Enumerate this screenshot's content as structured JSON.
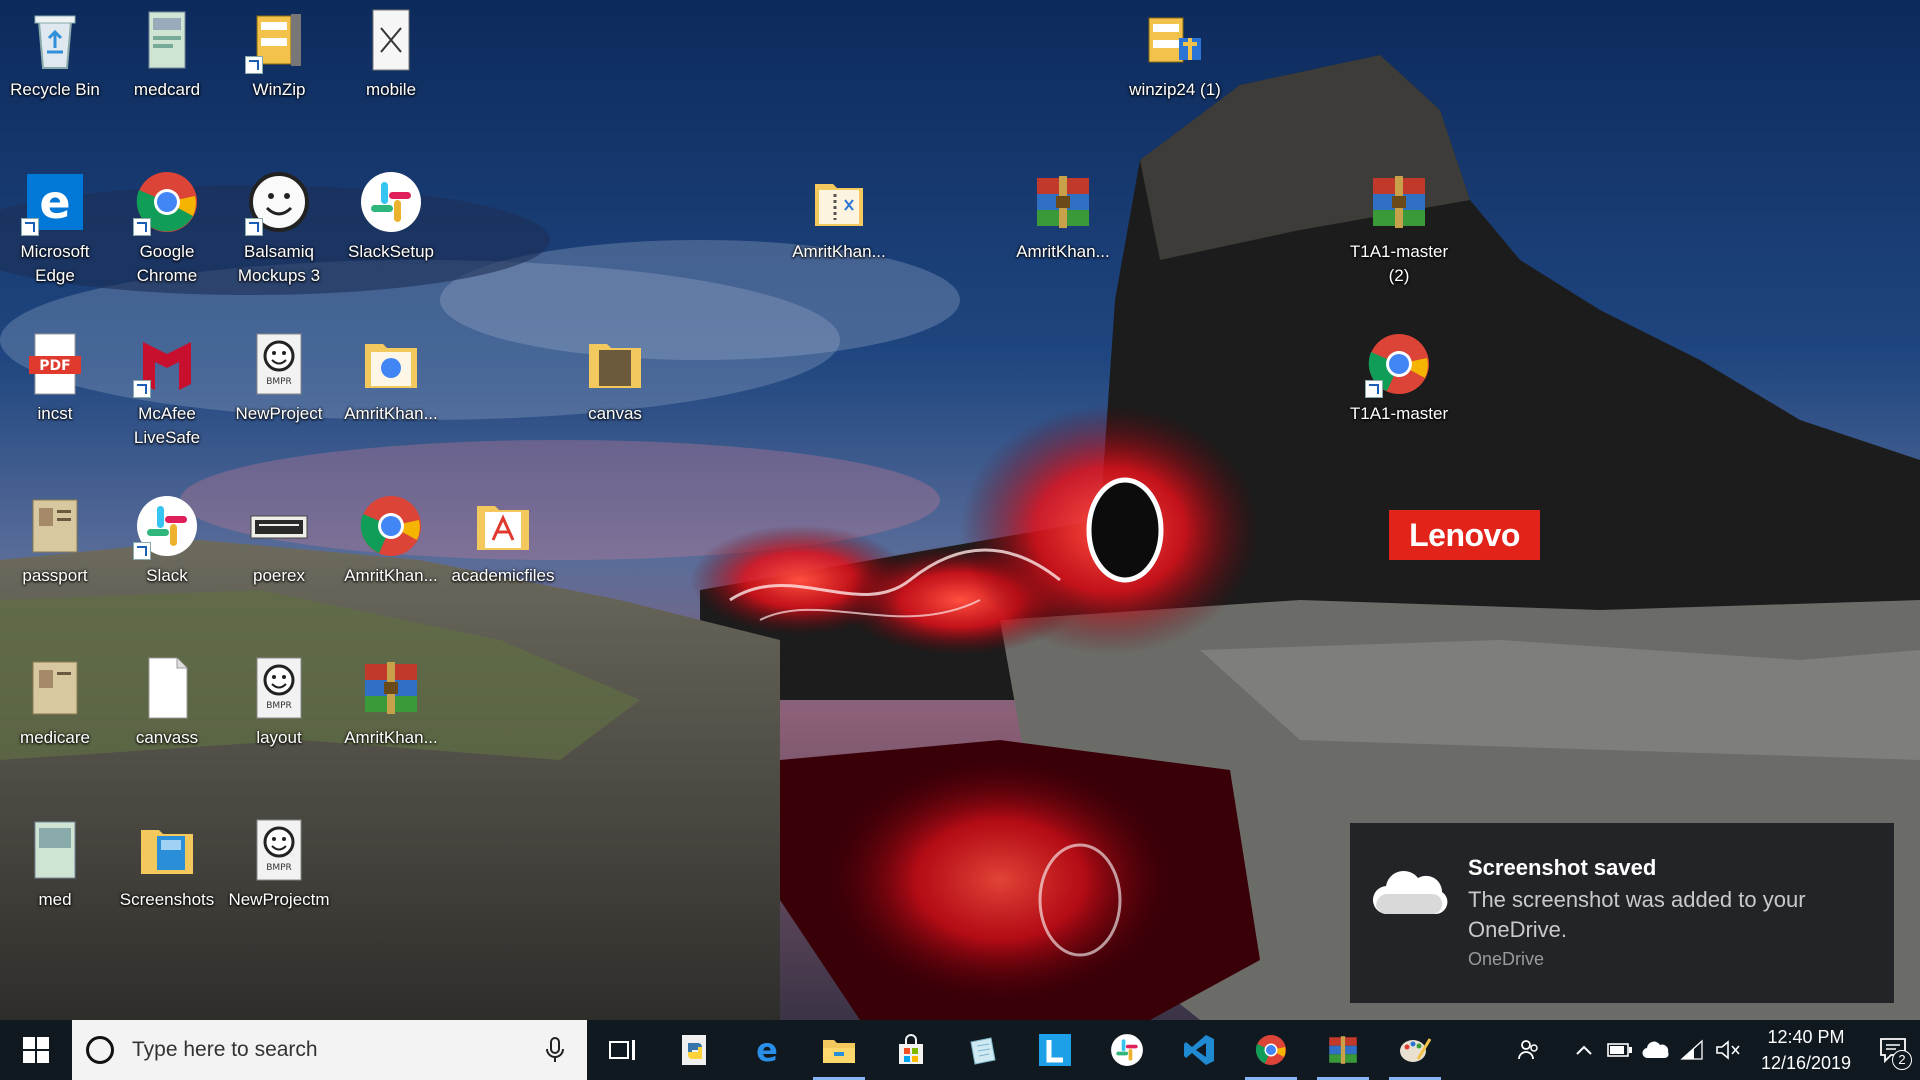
{
  "desktop": {
    "icons": [
      {
        "label": "Recycle Bin",
        "icon": "recycle-bin-icon"
      },
      {
        "label": "medcard",
        "icon": "image-file-icon"
      },
      {
        "label": "WinZip",
        "icon": "winzip-icon"
      },
      {
        "label": "mobile",
        "icon": "document-file-icon"
      },
      {
        "label": "winzip24 (1)",
        "icon": "installer-icon"
      },
      {
        "label": "Microsoft Edge",
        "icon": "edge-icon"
      },
      {
        "label": "Google Chrome",
        "icon": "chrome-icon"
      },
      {
        "label": "Balsamiq Mockups 3",
        "icon": "balsamiq-icon"
      },
      {
        "label": "SlackSetup",
        "icon": "slack-icon"
      },
      {
        "label": "AmritKhan...",
        "icon": "zip-folder-icon"
      },
      {
        "label": "AmritKhan...",
        "icon": "winrar-archive-icon"
      },
      {
        "label": "T1A1-master (2)",
        "icon": "winrar-archive-icon"
      },
      {
        "label": "incst",
        "icon": "pdf-file-icon"
      },
      {
        "label": "McAfee LiveSafe",
        "icon": "mcafee-icon"
      },
      {
        "label": "NewProject",
        "icon": "bmpr-file-icon"
      },
      {
        "label": "AmritKhan...",
        "icon": "folder-icon"
      },
      {
        "label": "canvas",
        "icon": "folder-icon"
      },
      {
        "label": "T1A1-master",
        "icon": "chrome-icon"
      },
      {
        "label": "passport",
        "icon": "image-file-icon"
      },
      {
        "label": "Slack",
        "icon": "slack-icon"
      },
      {
        "label": "poerex",
        "icon": "image-file-icon"
      },
      {
        "label": "AmritKhan...",
        "icon": "chrome-icon"
      },
      {
        "label": "academicfiles",
        "icon": "pdf-folder-icon"
      },
      {
        "label": "medicare",
        "icon": "image-file-icon"
      },
      {
        "label": "canvass",
        "icon": "blank-file-icon"
      },
      {
        "label": "layout",
        "icon": "bmpr-file-icon"
      },
      {
        "label": "AmritKhan...",
        "icon": "winrar-archive-icon"
      },
      {
        "label": "med",
        "icon": "image-file-icon"
      },
      {
        "label": "Screenshots",
        "icon": "folder-icon"
      },
      {
        "label": "NewProjectm",
        "icon": "bmpr-file-icon"
      }
    ],
    "bmpr_tag": "BMPR",
    "pdf_tag": "PDF",
    "lenovo_logo": "Lenovo"
  },
  "toast": {
    "title": "Screenshot saved",
    "body": "The screenshot was added to your OneDrive.",
    "app": "OneDrive",
    "icon": "onedrive-cloud-icon"
  },
  "taskbar": {
    "search_placeholder": "Type here to search",
    "pinned": [
      {
        "name": "task-view",
        "icon": "task-view-icon"
      },
      {
        "name": "python-idle",
        "icon": "python-icon"
      },
      {
        "name": "edge",
        "icon": "edge-icon"
      },
      {
        "name": "file-explorer",
        "icon": "folder-icon"
      },
      {
        "name": "store",
        "icon": "store-icon"
      },
      {
        "name": "notes",
        "icon": "notes-icon"
      },
      {
        "name": "lenovo-vantage",
        "icon": "lenovo-l-icon"
      },
      {
        "name": "slack",
        "icon": "slack-icon"
      },
      {
        "name": "vscode",
        "icon": "vscode-icon"
      },
      {
        "name": "chrome",
        "icon": "chrome-icon"
      },
      {
        "name": "winrar",
        "icon": "winrar-archive-icon"
      },
      {
        "name": "paint",
        "icon": "paint-icon"
      }
    ],
    "tray": {
      "time": "12:40 PM",
      "date": "12/16/2019",
      "notification_count": "2"
    }
  },
  "colors": {
    "taskbar_bg": "#101820",
    "lenovo_red": "#e2231a",
    "toast_bg": "#222428"
  }
}
